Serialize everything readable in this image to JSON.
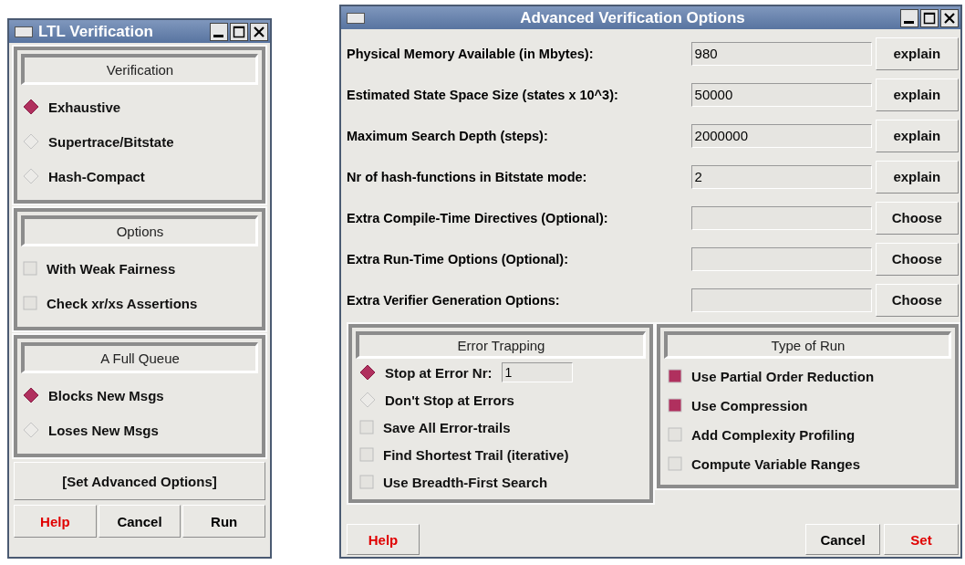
{
  "ltl_window": {
    "title": "LTL Verification",
    "groups": [
      {
        "title": "Verification",
        "items": [
          {
            "kind": "radio",
            "label": "Exhaustive",
            "selected": true
          },
          {
            "kind": "radio",
            "label": "Supertrace/Bitstate",
            "selected": false
          },
          {
            "kind": "radio",
            "label": "Hash-Compact",
            "selected": false
          }
        ]
      },
      {
        "title": "Options",
        "items": [
          {
            "kind": "checkbox",
            "label": "With Weak Fairness",
            "checked": false
          },
          {
            "kind": "checkbox",
            "label": "Check xr/xs Assertions",
            "checked": false
          }
        ]
      },
      {
        "title": "A Full Queue",
        "items": [
          {
            "kind": "radio",
            "label": "Blocks New Msgs",
            "selected": true
          },
          {
            "kind": "radio",
            "label": "Loses New Msgs",
            "selected": false
          }
        ]
      }
    ],
    "advanced_button": "[Set Advanced Options]",
    "buttons": [
      {
        "label": "Help",
        "color": "#e00000"
      },
      {
        "label": "Cancel",
        "color": "#000000"
      },
      {
        "label": "Run",
        "color": "#000000"
      }
    ]
  },
  "advanced_window": {
    "title": "Advanced Verification Options",
    "fields": [
      {
        "label": "Physical Memory Available (in Mbytes):",
        "value": "980",
        "button": "explain"
      },
      {
        "label": "Estimated State Space Size (states x 10^3):",
        "value": "50000",
        "button": "explain"
      },
      {
        "label": "Maximum Search Depth (steps):",
        "value": "2000000",
        "button": "explain"
      },
      {
        "label": "Nr of hash-functions in Bitstate mode:",
        "value": "2",
        "button": "explain"
      },
      {
        "label": "Extra Compile-Time Directives (Optional):",
        "button": "Choose"
      },
      {
        "label": "Extra Run-Time Options (Optional):",
        "button": "Choose"
      },
      {
        "label": "Extra Verifier Generation Options:",
        "button": "Choose"
      }
    ],
    "groups": [
      {
        "title": "Error Trapping",
        "items": [
          {
            "kind": "radio",
            "label": "Stop at Error Nr:",
            "selected": true,
            "value": "1"
          },
          {
            "kind": "radio",
            "label": "Don't Stop at Errors",
            "selected": false
          },
          {
            "kind": "checkbox",
            "label": "Save All Error-trails",
            "checked": false
          },
          {
            "kind": "checkbox",
            "label": "Find Shortest Trail (iterative)",
            "checked": false
          },
          {
            "kind": "checkbox",
            "label": "Use Breadth-First Search",
            "checked": false
          }
        ]
      },
      {
        "title": "Type of Run",
        "items": [
          {
            "kind": "checkbox",
            "label": "Use Partial Order Reduction",
            "checked": true
          },
          {
            "kind": "checkbox",
            "label": "Use Compression",
            "checked": true
          },
          {
            "kind": "checkbox",
            "label": "Add Complexity Profiling",
            "checked": false
          },
          {
            "kind": "checkbox",
            "label": "Compute Variable Ranges",
            "checked": false
          }
        ]
      }
    ],
    "buttons": [
      {
        "label": "Help",
        "color": "#e00000"
      },
      {
        "label": "Cancel",
        "color": "#000000"
      },
      {
        "label": "Set",
        "color": "#e00000"
      }
    ]
  }
}
